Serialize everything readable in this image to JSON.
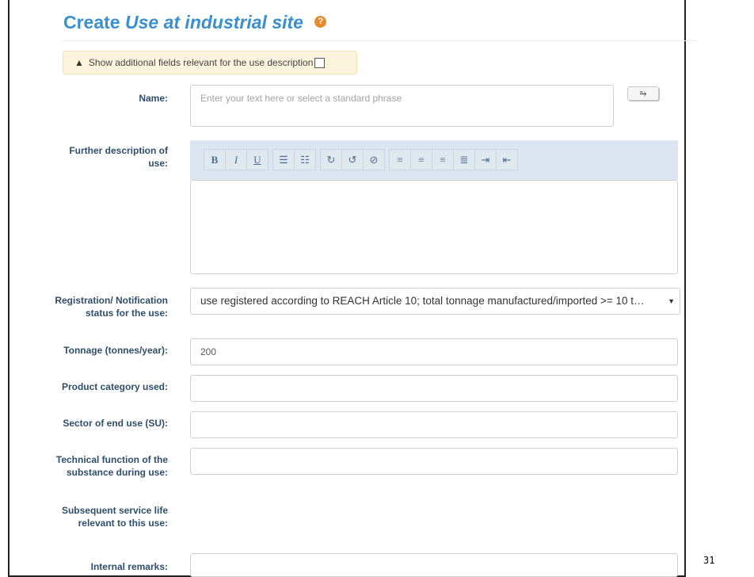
{
  "header": {
    "title_prefix": "Create",
    "title_italic": "Use at industrial site",
    "help_glyph": "?"
  },
  "notice": {
    "icon": "warning-icon",
    "text": "Show additional fields relevant for the use description",
    "checked": false
  },
  "form": {
    "name": {
      "label": "Name:",
      "placeholder": "Enter your text here or select a standard phrase",
      "button_glyph": "⥱"
    },
    "description": {
      "label": "Further description of use:",
      "value": ""
    },
    "toolbar": [
      {
        "name": "bold-button",
        "glyph": "B"
      },
      {
        "name": "italic-button",
        "glyph": "I"
      },
      {
        "name": "underline-button",
        "glyph": "U"
      },
      {
        "name": "bullet-list-button",
        "glyph": "☰"
      },
      {
        "name": "numbered-list-button",
        "glyph": "☷"
      },
      {
        "name": "redo-button",
        "glyph": "↻"
      },
      {
        "name": "undo-button",
        "glyph": "↺"
      },
      {
        "name": "clear-format-button",
        "glyph": "⊘"
      },
      {
        "name": "align-left-button",
        "glyph": "≡"
      },
      {
        "name": "align-center-button",
        "glyph": "≡"
      },
      {
        "name": "align-right-button",
        "glyph": "≡"
      },
      {
        "name": "justify-button",
        "glyph": "≣"
      },
      {
        "name": "indent-button",
        "glyph": "⇥"
      },
      {
        "name": "outdent-button",
        "glyph": "⇤"
      }
    ],
    "registration": {
      "label": "Registration/ Notification status for the use:",
      "value": "use registered according to REACH Article 10; total tonnage manufactured/imported >= 10 t…"
    },
    "tonnage": {
      "label": "Tonnage (tonnes/year):",
      "value": "200"
    },
    "product_category": {
      "label": "Product category used:",
      "value": ""
    },
    "sector": {
      "label": "Sector of end use (SU):",
      "value": ""
    },
    "technical_function": {
      "label": "Technical function of the substance during use:",
      "value": ""
    },
    "service_life": {
      "label": "Subsequent service life relevant to this use:"
    },
    "internal_remarks": {
      "label": "Internal remarks:",
      "value": ""
    }
  },
  "footer": {
    "page_number": "31"
  },
  "colors": {
    "title": "#3a8fd0",
    "label": "#2e4e69",
    "notice_bg": "#fcf4dd",
    "toolbar_bg": "#dbe6f2",
    "help": "#e8892b"
  }
}
